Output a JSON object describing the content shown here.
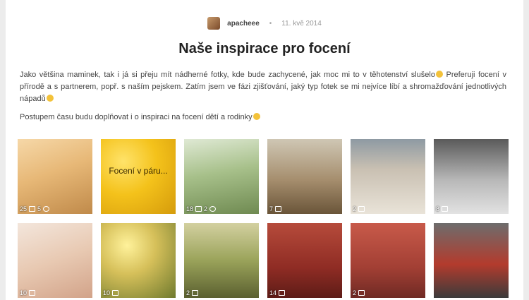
{
  "post": {
    "author": "apacheee",
    "separator": "•",
    "date": "11. kvě 2014",
    "title": "Naše inspirace pro focení",
    "paragraph1": "Jako většina maminek, tak i já si přeju mít nádherné fotky, kde bude zachycené, jak moc mi to v těhotenství slušelo",
    "paragraph1b": " Preferuji focení v přírodě a s partnerem, popř. s naším pejskem. Zatím jsem ve fázi zjišťování, jaký typ fotek se mi nejvíce líbí a shromažďování jednotlivých nápadů",
    "paragraph2": "Postupem času budu doplňovat i o inspiraci na focení dětí a rodinky"
  },
  "tiles": [
    {
      "label": "",
      "likes": "25",
      "comments": "5"
    },
    {
      "label": "Focení v páru...",
      "likes": "",
      "comments": ""
    },
    {
      "label": "",
      "likes": "18",
      "comments": "2"
    },
    {
      "label": "",
      "likes": "7",
      "comments": ""
    },
    {
      "label": "",
      "likes": "2",
      "comments": ""
    },
    {
      "label": "",
      "likes": "8",
      "comments": ""
    },
    {
      "label": "",
      "likes": "10",
      "comments": ""
    },
    {
      "label": "",
      "likes": "10",
      "comments": ""
    },
    {
      "label": "",
      "likes": "2",
      "comments": ""
    },
    {
      "label": "",
      "likes": "14",
      "comments": ""
    },
    {
      "label": "",
      "likes": "2",
      "comments": ""
    },
    {
      "label": "",
      "likes": "",
      "comments": ""
    }
  ],
  "icons": {
    "like": "thumbs-up-icon",
    "comment": "speech-bubble-icon",
    "emoji": "smiley-icon"
  }
}
